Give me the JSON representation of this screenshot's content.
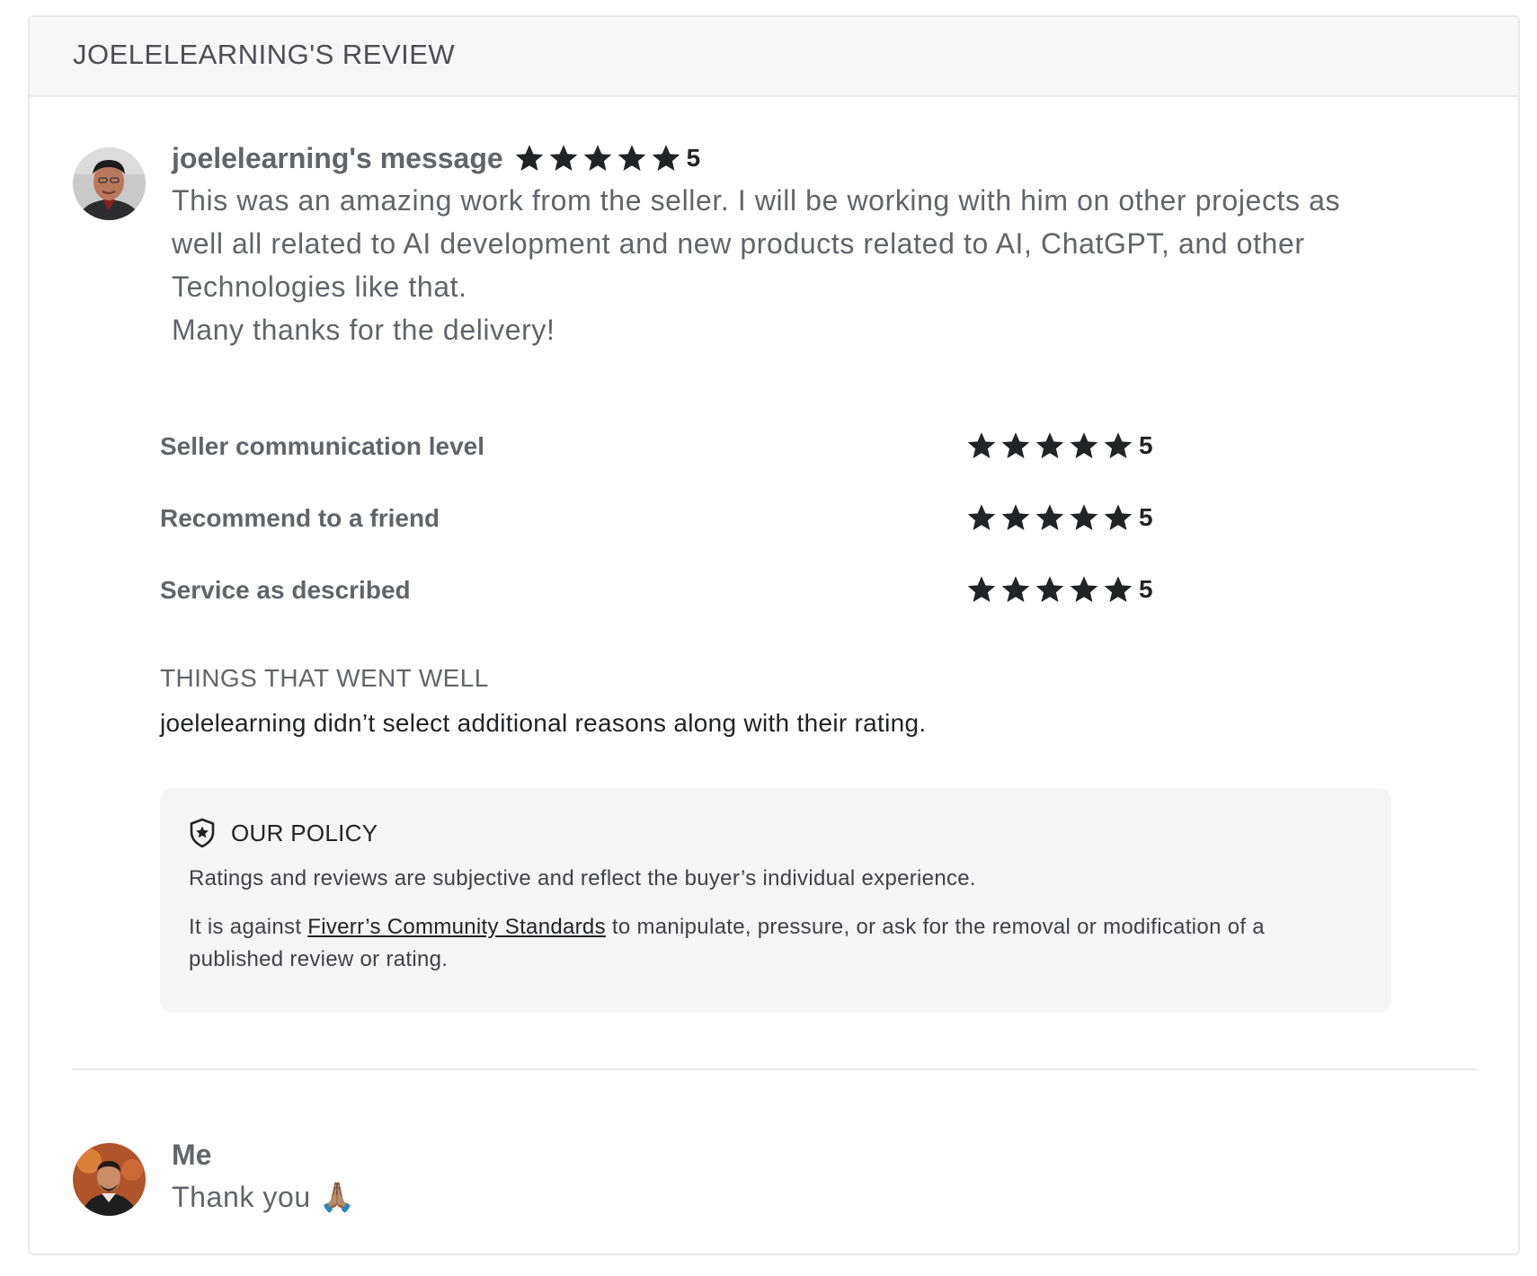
{
  "review": {
    "title": "JOELELEARNING'S REVIEW",
    "buyer_message": {
      "author": "joelelearning's message",
      "rating": "5",
      "stars": 5,
      "lines": [
        "This was an amazing work from the seller. I will be working with him on other projects as",
        "well all related to AI development and new products related to AI, ChatGPT, and other",
        "Technologies like that.",
        "Many thanks for the delivery!"
      ]
    },
    "criteria": [
      {
        "label": "Seller communication level",
        "rating": "5",
        "stars": 5
      },
      {
        "label": "Recommend to a friend",
        "rating": "5",
        "stars": 5
      },
      {
        "label": "Service as described",
        "rating": "5",
        "stars": 5
      }
    ],
    "things_went_well": {
      "heading": "THINGS THAT WENT WELL",
      "text": "joelelearning didn’t select additional reasons along with their rating."
    },
    "policy": {
      "icon": "shield-star-icon",
      "title": "OUR POLICY",
      "line1": "Ratings and reviews are subjective and reflect the buyer’s individual experience.",
      "line2_pre": "It is against ",
      "line2_link": "Fiverr’s Community Standards",
      "line2_post": " to manipulate, pressure, or ask for the removal or modification of a published review or rating."
    },
    "reply": {
      "author": "Me",
      "text": "Thank you 🙏🏽"
    }
  },
  "colors": {
    "star": "#222325",
    "text_muted": "#62646a",
    "header_bg": "#f7f7f7",
    "policy_bg": "#f5f5f5"
  }
}
